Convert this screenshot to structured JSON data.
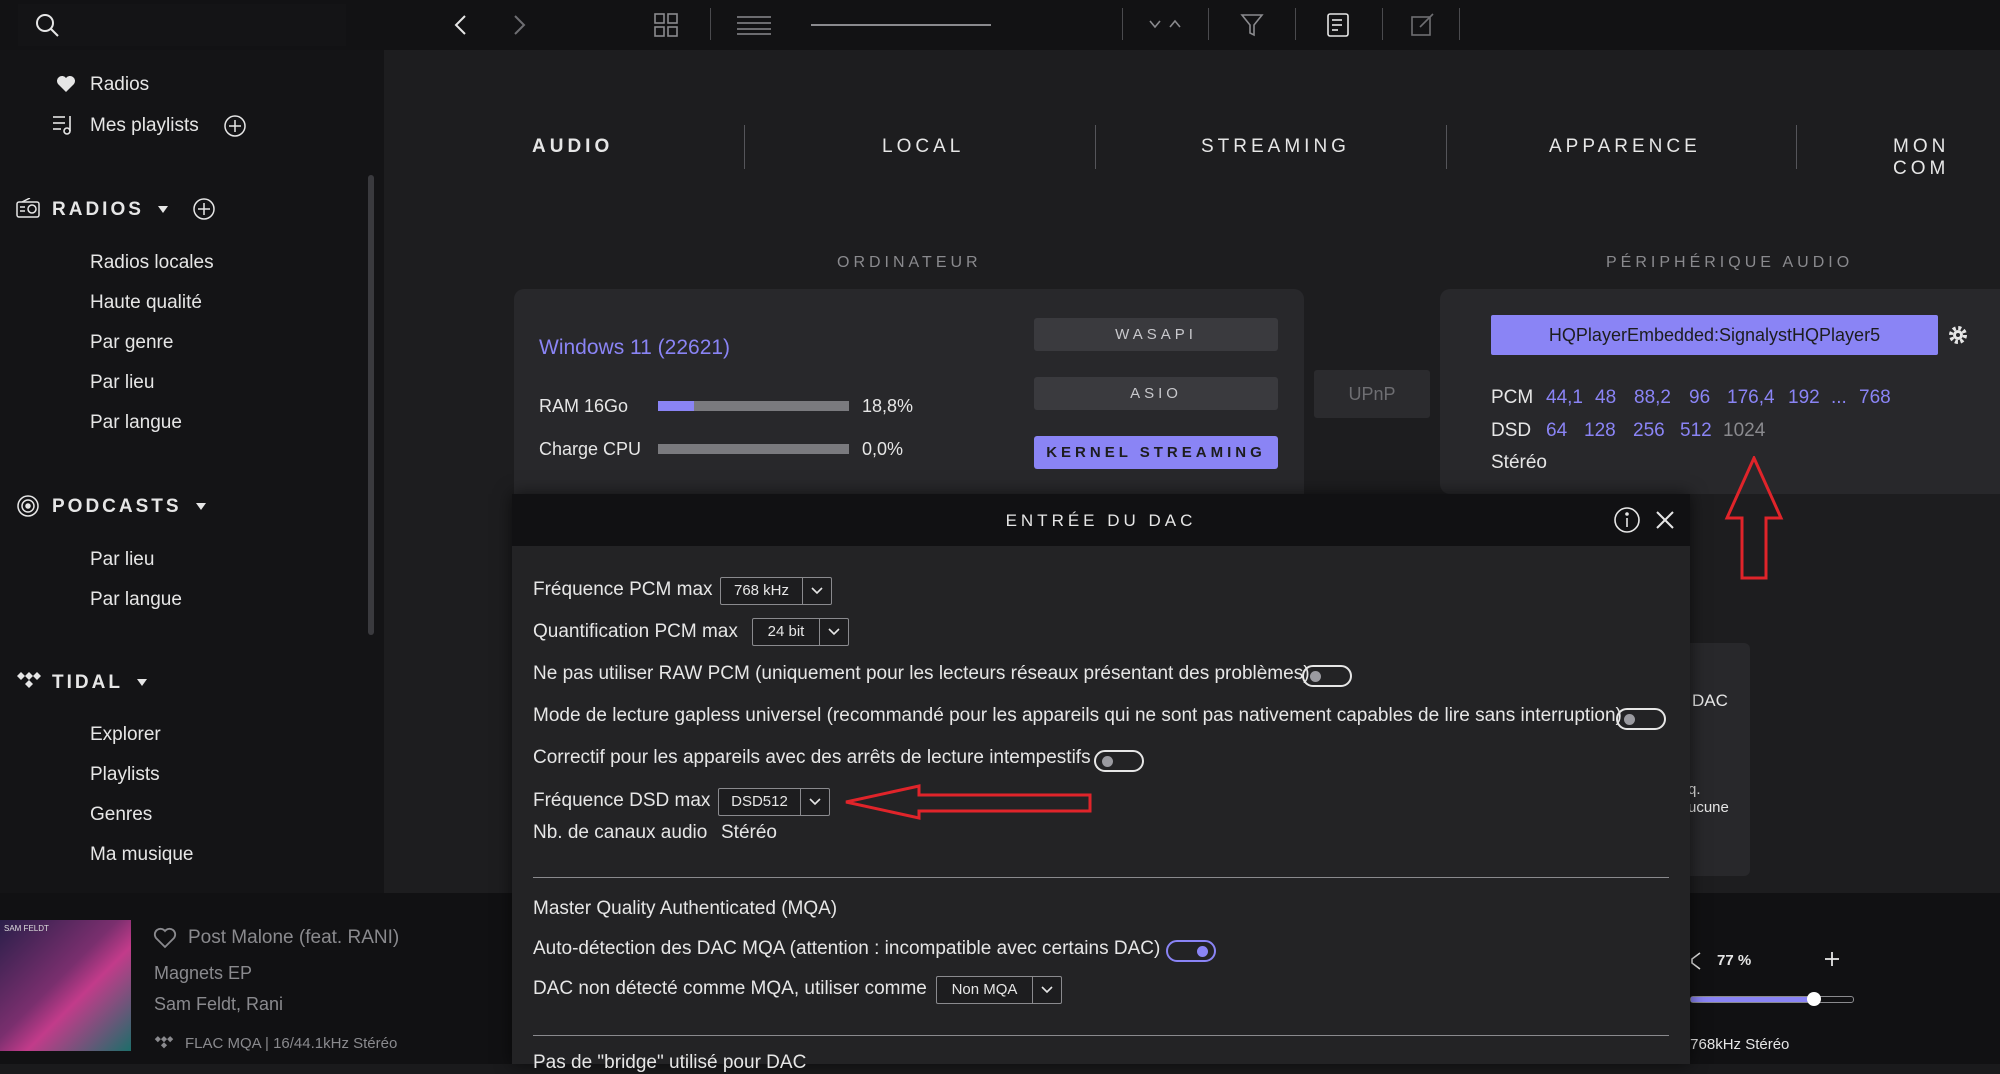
{
  "colors": {
    "accent": "#8a84f5",
    "red_annotation": "#e0242a",
    "background": "#1d1d1f",
    "sidebar": "#141416"
  },
  "sidebar": {
    "fav_radios": "Radios",
    "my_playlists": "Mes playlists",
    "radios": {
      "header": "RADIOS",
      "items": [
        "Radios locales",
        "Haute qualité",
        "Par genre",
        "Par lieu",
        "Par langue"
      ]
    },
    "podcasts": {
      "header": "PODCASTS",
      "items": [
        "Par lieu",
        "Par langue"
      ]
    },
    "tidal": {
      "header": "TIDAL",
      "items": [
        "Explorer",
        "Playlists",
        "Genres",
        "Ma musique"
      ]
    }
  },
  "tabs": [
    {
      "label": "AUDIO",
      "active": true
    },
    {
      "label": "LOCAL"
    },
    {
      "label": "STREAMING"
    },
    {
      "label": "APPARENCE"
    },
    {
      "label": "MON COM"
    }
  ],
  "computer": {
    "section": "ORDINATEUR",
    "os": "Windows 11 (22621)",
    "ram_label": "RAM 16Go",
    "ram_value": "18,8%",
    "ram_fraction": 0.188,
    "cpu_label": "Charge CPU",
    "cpu_value": "0,0%",
    "cpu_fraction": 0.0,
    "modes": [
      "WASAPI",
      "ASIO",
      "KERNEL STREAMING"
    ],
    "active_mode": "KERNEL STREAMING",
    "upnp": "UPnP"
  },
  "device": {
    "section": "PÉRIPHÉRIQUE AUDIO",
    "name": "HQPlayerEmbedded:SignalystHQPlayer5",
    "pcm_label": "PCM",
    "pcm_rates": [
      "44,1",
      "48",
      "88,2",
      "96",
      "176,4",
      "192",
      "...",
      "768"
    ],
    "dsd_label": "DSD",
    "dsd_rates": [
      "64",
      "128",
      "256",
      "512"
    ],
    "dsd_disabled": "1024",
    "channels": "Stéréo"
  },
  "behind_card": {
    "dac": "DAC",
    "line1": "q.",
    "line2": "ucune"
  },
  "dialog": {
    "title": "ENTRÉE DU DAC",
    "pcm_freq": {
      "label": "Fréquence PCM max",
      "value": "768 kHz"
    },
    "pcm_quant": {
      "label": "Quantification PCM max",
      "value": "24 bit"
    },
    "raw_pcm": {
      "label": "Ne pas utiliser RAW PCM (uniquement pour les lecteurs réseaux présentant des problèmes)",
      "on": false
    },
    "gapless": {
      "label": "Mode de lecture gapless universel (recommandé pour les appareils qui ne sont pas nativement capables de lire sans interruption)",
      "on": false
    },
    "fix_stops": {
      "label": "Correctif pour les appareils avec des arrêts de lecture intempestifs",
      "on": false
    },
    "dsd_freq": {
      "label": "Fréquence DSD max",
      "value": "DSD512"
    },
    "channels": {
      "label": "Nb. de canaux audio",
      "value": "Stéréo"
    },
    "mqa_section": "Master Quality Authenticated (MQA)",
    "mqa_auto": {
      "label": "Auto-détection des DAC MQA (attention : incompatible avec certains DAC)",
      "on": true
    },
    "mqa_fallback": {
      "label": "DAC non détecté comme MQA, utiliser comme",
      "value": "Non MQA"
    },
    "cut_text": "Pas de \"bridge\" utilisé pour DAC"
  },
  "player": {
    "title": "Post Malone (feat. RANI)",
    "album": "Magnets EP",
    "artists": "Sam Feldt, Rani",
    "quality": "FLAC MQA | 16/44.1kHz Stéréo",
    "volume": "77 %",
    "volume_fraction": 0.77,
    "output_format": "/768kHz Stéréo",
    "cover_text": "SAM FELDT"
  }
}
